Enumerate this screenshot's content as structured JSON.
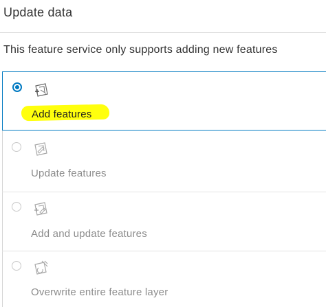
{
  "header": {
    "title": "Update data"
  },
  "description": "This feature service only supports adding new features",
  "options": [
    {
      "label": "Add features",
      "icon": "add-features-icon",
      "selected": true,
      "enabled": true
    },
    {
      "label": "Update features",
      "icon": "update-features-icon",
      "selected": false,
      "enabled": false
    },
    {
      "label": "Add and update features",
      "icon": "add-update-features-icon",
      "selected": false,
      "enabled": false
    },
    {
      "label": "Overwrite entire feature layer",
      "icon": "overwrite-layer-icon",
      "selected": false,
      "enabled": false
    }
  ],
  "colors": {
    "accent": "#0079c1",
    "highlight": "#ffff00",
    "disabled_text": "#8c8c8c"
  }
}
